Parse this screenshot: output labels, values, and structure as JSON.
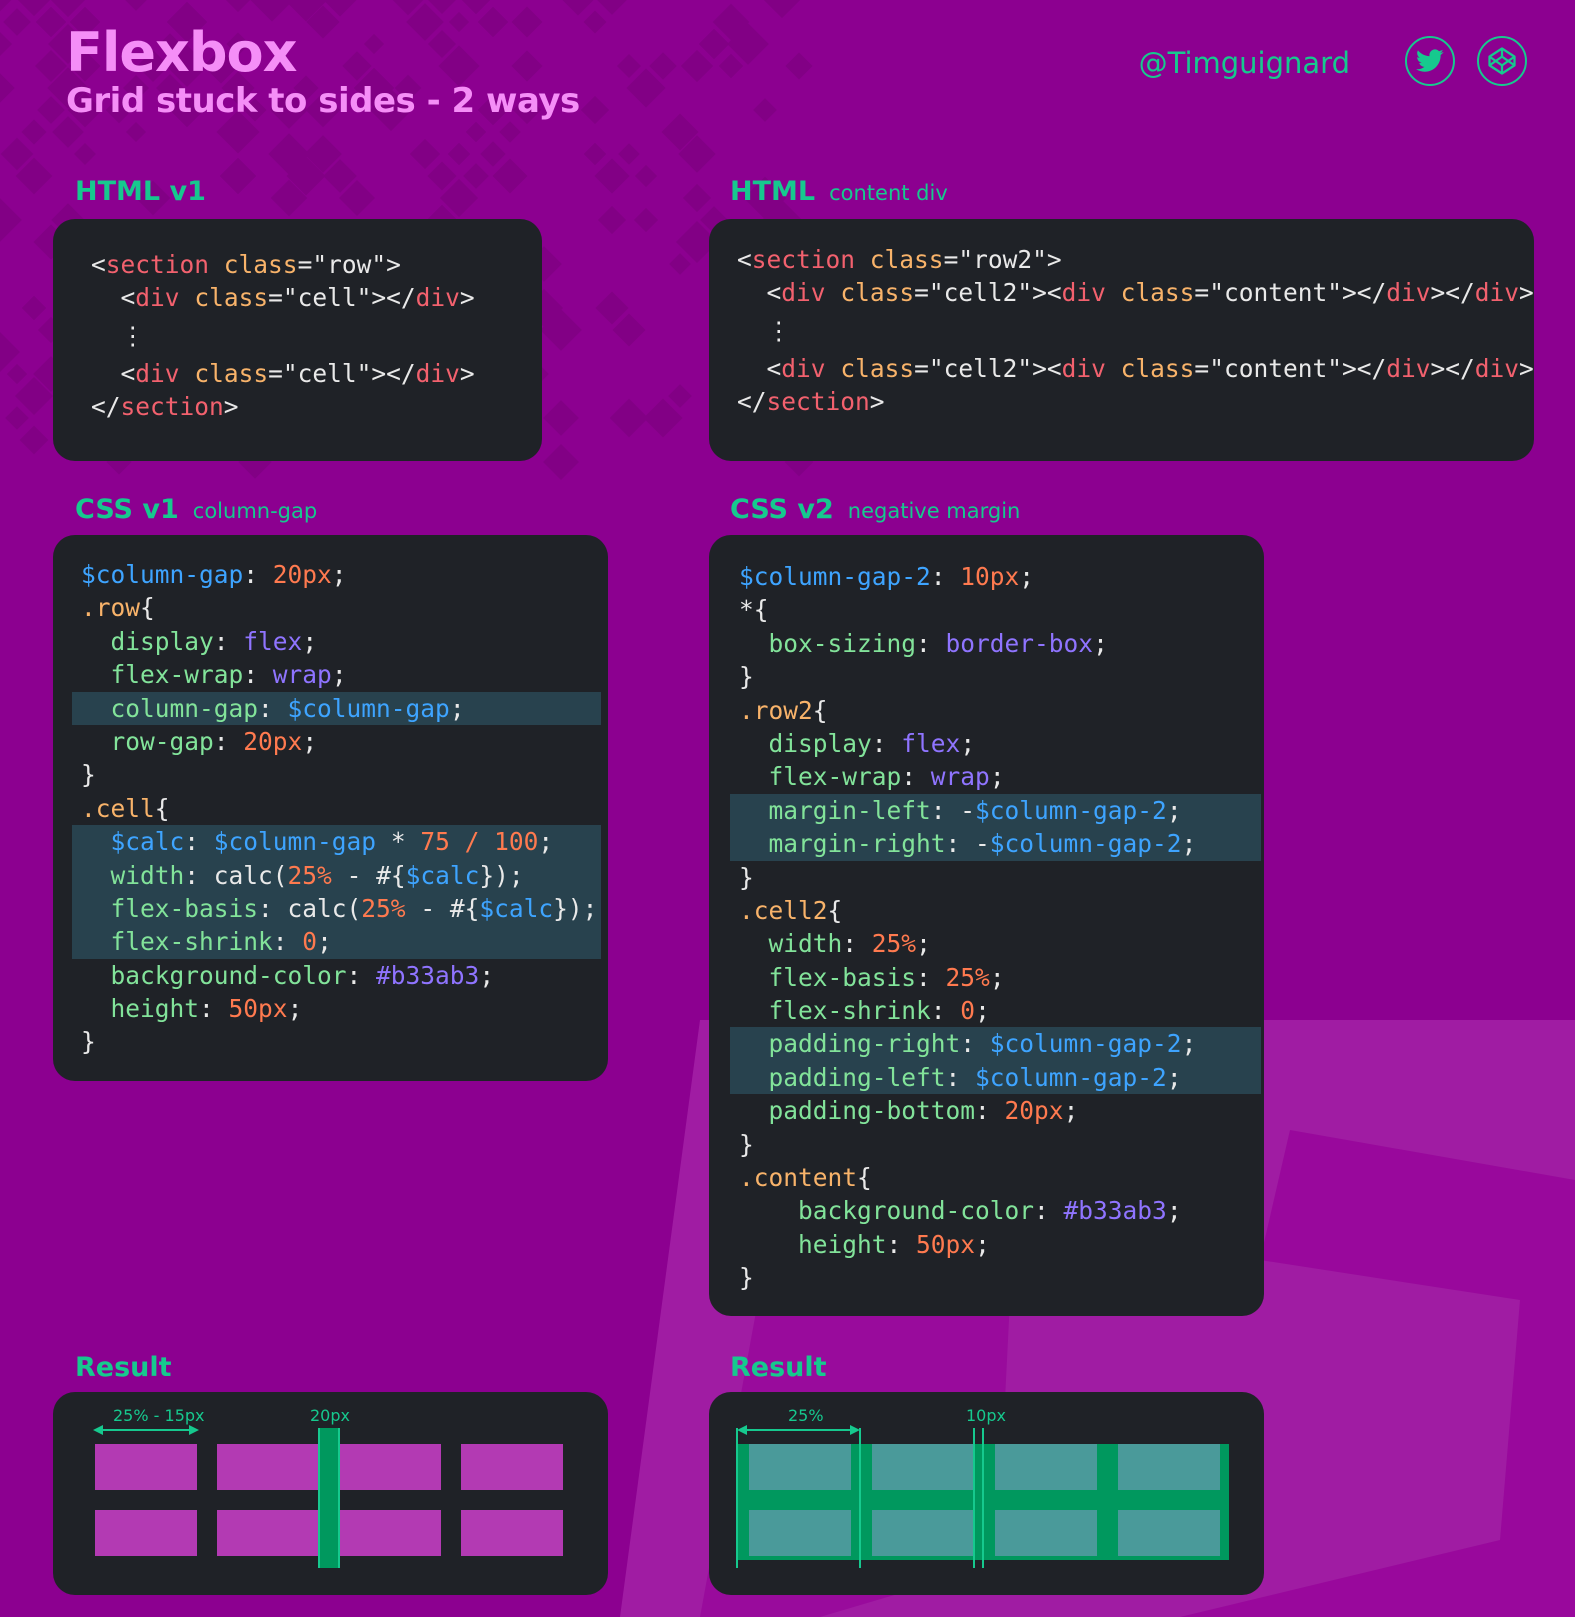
{
  "header": {
    "title": "Flexbox",
    "subtitle": "Grid stuck to sides - 2 ways",
    "handle": "@Timguignard"
  },
  "icons": {
    "twitter": "twitter-bird-icon",
    "codepen": "codepen-cube-icon"
  },
  "colors": {
    "background": "#8c0090",
    "panel": "#1f2227",
    "accent": "#16c98e",
    "title": "#f58ef7",
    "highlight": "#28424e",
    "cell_v1": "#b33ab3",
    "cell_v2": "#4a9a9a",
    "gap_v2": "#00985e"
  },
  "sections": {
    "html_v1": {
      "label": "HTML v1"
    },
    "html_v2": {
      "label": "HTML",
      "sublabel": "content div"
    },
    "css_v1": {
      "label": "CSS v1",
      "sublabel": "column-gap"
    },
    "css_v2": {
      "label": "CSS v2",
      "sublabel": "negative margin"
    },
    "result_v1": {
      "label": "Result",
      "dim_cell": "25% - 15px",
      "dim_gap": "20px"
    },
    "result_v2": {
      "label": "Result",
      "dim_cell": "25%",
      "dim_gap": "10px"
    }
  },
  "code": {
    "html_v1": [
      {
        "indent": 0,
        "tokens": [
          [
            "t-punct",
            "<"
          ],
          [
            "t-tag",
            "section"
          ],
          [
            "t-punct",
            " "
          ],
          [
            "t-attr",
            "class"
          ],
          [
            "t-punct",
            "="
          ],
          [
            "t-str",
            "\"row\""
          ],
          [
            "t-punct",
            ">"
          ]
        ]
      },
      {
        "indent": 1,
        "tokens": [
          [
            "t-punct",
            "<"
          ],
          [
            "t-tag",
            "div"
          ],
          [
            "t-punct",
            " "
          ],
          [
            "t-attr",
            "class"
          ],
          [
            "t-punct",
            "="
          ],
          [
            "t-str",
            "\"cell\""
          ],
          [
            "t-punct",
            "></"
          ],
          [
            "t-tag",
            "div"
          ],
          [
            "t-punct",
            ">"
          ]
        ]
      },
      {
        "indent": 1,
        "vdots": true,
        "tokens": [
          [
            "t-punct",
            "⋮"
          ]
        ]
      },
      {
        "indent": 1,
        "tokens": [
          [
            "t-punct",
            "<"
          ],
          [
            "t-tag",
            "div"
          ],
          [
            "t-punct",
            " "
          ],
          [
            "t-attr",
            "class"
          ],
          [
            "t-punct",
            "="
          ],
          [
            "t-str",
            "\"cell\""
          ],
          [
            "t-punct",
            "></"
          ],
          [
            "t-tag",
            "div"
          ],
          [
            "t-punct",
            ">"
          ]
        ]
      },
      {
        "indent": 0,
        "tokens": [
          [
            "t-punct",
            "</"
          ],
          [
            "t-tag",
            "section"
          ],
          [
            "t-punct",
            ">"
          ]
        ]
      }
    ],
    "html_v2": [
      {
        "indent": 0,
        "tokens": [
          [
            "t-punct",
            "<"
          ],
          [
            "t-tag",
            "section"
          ],
          [
            "t-punct",
            " "
          ],
          [
            "t-attr",
            "class"
          ],
          [
            "t-punct",
            "="
          ],
          [
            "t-str",
            "\"row2\""
          ],
          [
            "t-punct",
            ">"
          ]
        ]
      },
      {
        "indent": 1,
        "tokens": [
          [
            "t-punct",
            "<"
          ],
          [
            "t-tag",
            "div"
          ],
          [
            "t-punct",
            " "
          ],
          [
            "t-attr",
            "class"
          ],
          [
            "t-punct",
            "="
          ],
          [
            "t-str",
            "\"cell2\""
          ],
          [
            "t-punct",
            "><"
          ],
          [
            "t-tag",
            "div"
          ],
          [
            "t-punct",
            " "
          ],
          [
            "t-attr",
            "class"
          ],
          [
            "t-punct",
            "="
          ],
          [
            "t-str",
            "\"content\""
          ],
          [
            "t-punct",
            "></"
          ],
          [
            "t-tag",
            "div"
          ],
          [
            "t-punct",
            "></"
          ],
          [
            "t-tag",
            "div"
          ],
          [
            "t-punct",
            ">"
          ]
        ]
      },
      {
        "indent": 1,
        "vdots": true,
        "tokens": [
          [
            "t-punct",
            "⋮"
          ]
        ]
      },
      {
        "indent": 1,
        "tokens": [
          [
            "t-punct",
            "<"
          ],
          [
            "t-tag",
            "div"
          ],
          [
            "t-punct",
            " "
          ],
          [
            "t-attr",
            "class"
          ],
          [
            "t-punct",
            "="
          ],
          [
            "t-str",
            "\"cell2\""
          ],
          [
            "t-punct",
            "><"
          ],
          [
            "t-tag",
            "div"
          ],
          [
            "t-punct",
            " "
          ],
          [
            "t-attr",
            "class"
          ],
          [
            "t-punct",
            "="
          ],
          [
            "t-str",
            "\"content\""
          ],
          [
            "t-punct",
            "></"
          ],
          [
            "t-tag",
            "div"
          ],
          [
            "t-punct",
            "></"
          ],
          [
            "t-tag",
            "div"
          ],
          [
            "t-punct",
            ">"
          ]
        ]
      },
      {
        "indent": 0,
        "tokens": [
          [
            "t-punct",
            "</"
          ],
          [
            "t-tag",
            "section"
          ],
          [
            "t-punct",
            ">"
          ]
        ]
      }
    ],
    "css_v1": [
      {
        "indent": 0,
        "tokens": [
          [
            "t-var",
            "$column-gap"
          ],
          [
            "t-punct",
            ": "
          ],
          [
            "t-num",
            "20px"
          ],
          [
            "t-punct",
            ";"
          ]
        ]
      },
      {
        "indent": 0,
        "tokens": [
          [
            "t-sel",
            ".row"
          ],
          [
            "t-punct",
            "{"
          ]
        ]
      },
      {
        "indent": 1,
        "tokens": [
          [
            "t-prop",
            "display"
          ],
          [
            "t-punct",
            ": "
          ],
          [
            "t-kw",
            "flex"
          ],
          [
            "t-punct",
            ";"
          ]
        ]
      },
      {
        "indent": 1,
        "tokens": [
          [
            "t-prop",
            "flex-wrap"
          ],
          [
            "t-punct",
            ": "
          ],
          [
            "t-kw",
            "wrap"
          ],
          [
            "t-punct",
            ";"
          ]
        ]
      },
      {
        "indent": 1,
        "hl": true,
        "tokens": [
          [
            "t-prop",
            "column-gap"
          ],
          [
            "t-punct",
            ": "
          ],
          [
            "t-var",
            "$column-gap"
          ],
          [
            "t-punct",
            ";"
          ]
        ]
      },
      {
        "indent": 1,
        "tokens": [
          [
            "t-prop",
            "row-gap"
          ],
          [
            "t-punct",
            ": "
          ],
          [
            "t-num",
            "20px"
          ],
          [
            "t-punct",
            ";"
          ]
        ]
      },
      {
        "indent": 0,
        "tokens": [
          [
            "t-punct",
            "}"
          ]
        ]
      },
      {
        "indent": 0,
        "tokens": [
          [
            "t-sel",
            ".cell"
          ],
          [
            "t-punct",
            "{"
          ]
        ]
      },
      {
        "indent": 1,
        "hl": true,
        "tokens": [
          [
            "t-var",
            "$calc"
          ],
          [
            "t-punct",
            ": "
          ],
          [
            "t-var",
            "$column-gap"
          ],
          [
            "t-op",
            " * "
          ],
          [
            "t-num",
            "75 / 100"
          ],
          [
            "t-punct",
            ";"
          ]
        ]
      },
      {
        "indent": 1,
        "hl": true,
        "tokens": [
          [
            "t-prop",
            "width"
          ],
          [
            "t-punct",
            ": calc("
          ],
          [
            "t-num",
            "25%"
          ],
          [
            "t-op",
            " - #{"
          ],
          [
            "t-var",
            "$calc"
          ],
          [
            "t-punct",
            "});"
          ]
        ]
      },
      {
        "indent": 1,
        "hl": true,
        "tokens": [
          [
            "t-prop",
            "flex-basis"
          ],
          [
            "t-punct",
            ": calc("
          ],
          [
            "t-num",
            "25%"
          ],
          [
            "t-op",
            " - #{"
          ],
          [
            "t-var",
            "$calc"
          ],
          [
            "t-punct",
            "});"
          ]
        ]
      },
      {
        "indent": 1,
        "hl": true,
        "tokens": [
          [
            "t-prop",
            "flex-shrink"
          ],
          [
            "t-punct",
            ": "
          ],
          [
            "t-num",
            "0"
          ],
          [
            "t-punct",
            ";"
          ]
        ]
      },
      {
        "indent": 1,
        "tokens": [
          [
            "t-prop",
            "background-color"
          ],
          [
            "t-punct",
            ": "
          ],
          [
            "t-hex",
            "#b33ab3"
          ],
          [
            "t-punct",
            ";"
          ]
        ]
      },
      {
        "indent": 1,
        "tokens": [
          [
            "t-prop",
            "height"
          ],
          [
            "t-punct",
            ": "
          ],
          [
            "t-num",
            "50px"
          ],
          [
            "t-punct",
            ";"
          ]
        ]
      },
      {
        "indent": 0,
        "tokens": [
          [
            "t-punct",
            "}"
          ]
        ]
      }
    ],
    "css_v2": [
      {
        "indent": 0,
        "tokens": [
          [
            "t-var",
            "$column-gap-2"
          ],
          [
            "t-punct",
            ": "
          ],
          [
            "t-num",
            "10px"
          ],
          [
            "t-punct",
            ";"
          ]
        ]
      },
      {
        "indent": 0,
        "tokens": [
          [
            "t-punct",
            "*{"
          ]
        ]
      },
      {
        "indent": 1,
        "tokens": [
          [
            "t-prop",
            "box-sizing"
          ],
          [
            "t-punct",
            ": "
          ],
          [
            "t-kw",
            "border-box"
          ],
          [
            "t-punct",
            ";"
          ]
        ]
      },
      {
        "indent": 0,
        "tokens": [
          [
            "t-punct",
            "}"
          ]
        ]
      },
      {
        "indent": 0,
        "tokens": [
          [
            "t-sel",
            ".row2"
          ],
          [
            "t-punct",
            "{"
          ]
        ]
      },
      {
        "indent": 1,
        "tokens": [
          [
            "t-prop",
            "display"
          ],
          [
            "t-punct",
            ": "
          ],
          [
            "t-kw",
            "flex"
          ],
          [
            "t-punct",
            ";"
          ]
        ]
      },
      {
        "indent": 1,
        "tokens": [
          [
            "t-prop",
            "flex-wrap"
          ],
          [
            "t-punct",
            ": "
          ],
          [
            "t-kw",
            "wrap"
          ],
          [
            "t-punct",
            ";"
          ]
        ]
      },
      {
        "indent": 1,
        "hl": true,
        "tokens": [
          [
            "t-prop",
            "margin-left"
          ],
          [
            "t-punct",
            ": -"
          ],
          [
            "t-var",
            "$column-gap-2"
          ],
          [
            "t-punct",
            ";"
          ]
        ]
      },
      {
        "indent": 1,
        "hl": true,
        "tokens": [
          [
            "t-prop",
            "margin-right"
          ],
          [
            "t-punct",
            ": -"
          ],
          [
            "t-var",
            "$column-gap-2"
          ],
          [
            "t-punct",
            ";"
          ]
        ]
      },
      {
        "indent": 0,
        "tokens": [
          [
            "t-punct",
            "}"
          ]
        ]
      },
      {
        "indent": 0,
        "tokens": [
          [
            "t-sel",
            ".cell2"
          ],
          [
            "t-punct",
            "{"
          ]
        ]
      },
      {
        "indent": 1,
        "tokens": [
          [
            "t-prop",
            "width"
          ],
          [
            "t-punct",
            ": "
          ],
          [
            "t-num",
            "25%"
          ],
          [
            "t-punct",
            ";"
          ]
        ]
      },
      {
        "indent": 1,
        "tokens": [
          [
            "t-prop",
            "flex-basis"
          ],
          [
            "t-punct",
            ": "
          ],
          [
            "t-num",
            "25%"
          ],
          [
            "t-punct",
            ";"
          ]
        ]
      },
      {
        "indent": 1,
        "tokens": [
          [
            "t-prop",
            "flex-shrink"
          ],
          [
            "t-punct",
            ": "
          ],
          [
            "t-num",
            "0"
          ],
          [
            "t-punct",
            ";"
          ]
        ]
      },
      {
        "indent": 1,
        "hl": true,
        "tokens": [
          [
            "t-prop",
            "padding-right"
          ],
          [
            "t-punct",
            ": "
          ],
          [
            "t-var",
            "$column-gap-2"
          ],
          [
            "t-punct",
            ";"
          ]
        ]
      },
      {
        "indent": 1,
        "hl": true,
        "tokens": [
          [
            "t-prop",
            "padding-left"
          ],
          [
            "t-punct",
            ": "
          ],
          [
            "t-var",
            "$column-gap-2"
          ],
          [
            "t-punct",
            ";"
          ]
        ]
      },
      {
        "indent": 1,
        "tokens": [
          [
            "t-prop",
            "padding-bottom"
          ],
          [
            "t-punct",
            ": "
          ],
          [
            "t-num",
            "20px"
          ],
          [
            "t-punct",
            ";"
          ]
        ]
      },
      {
        "indent": 0,
        "tokens": [
          [
            "t-punct",
            "}"
          ]
        ]
      },
      {
        "indent": 0,
        "tokens": [
          [
            "t-sel",
            ".content"
          ],
          [
            "t-punct",
            "{"
          ]
        ]
      },
      {
        "indent": 2,
        "tokens": [
          [
            "t-prop",
            "background-color"
          ],
          [
            "t-punct",
            ": "
          ],
          [
            "t-hex",
            "#b33ab3"
          ],
          [
            "t-punct",
            ";"
          ]
        ]
      },
      {
        "indent": 2,
        "tokens": [
          [
            "t-prop",
            "height"
          ],
          [
            "t-punct",
            ": "
          ],
          [
            "t-num",
            "50px"
          ],
          [
            "t-punct",
            ";"
          ]
        ]
      },
      {
        "indent": 0,
        "tokens": [
          [
            "t-punct",
            "}"
          ]
        ]
      }
    ]
  }
}
